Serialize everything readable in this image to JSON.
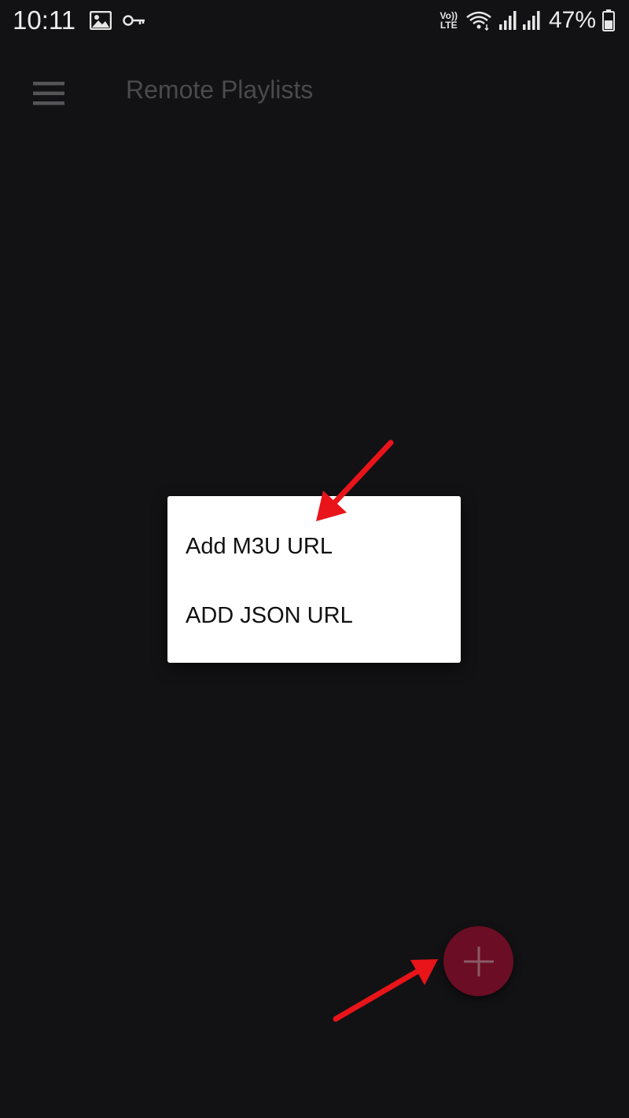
{
  "status_bar": {
    "time": "10:11",
    "network_label_top": "Vo))",
    "network_label_bottom": "LTE",
    "battery_percent": "47%",
    "icons": [
      "image-icon",
      "vpn-key-icon",
      "wifi-icon",
      "signal-icon",
      "signal-icon-2",
      "battery-icon"
    ]
  },
  "app_bar": {
    "title": "Remote Playlists",
    "menu_icon": "hamburger-menu-icon"
  },
  "popup_menu": {
    "items": [
      {
        "label": "Add M3U URL"
      },
      {
        "label": "ADD JSON URL"
      }
    ]
  },
  "fab": {
    "icon": "plus-icon",
    "color": "#6b0d24"
  },
  "colors": {
    "background": "#121214",
    "annotation_arrow": "#e8141a"
  }
}
